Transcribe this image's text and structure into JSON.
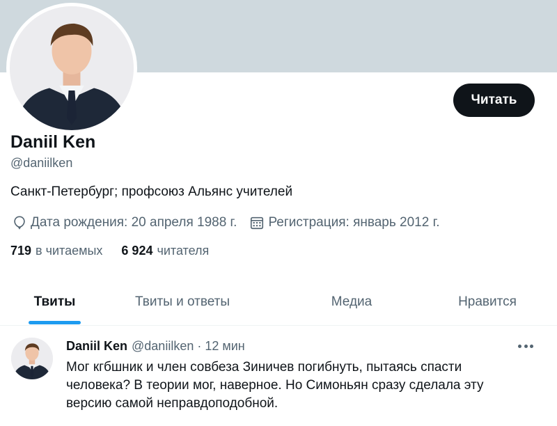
{
  "profile": {
    "name": "Daniil Ken",
    "handle": "@daniilken",
    "bio": "Санкт-Петербург; профсоюз Альянс учителей",
    "birthday": "Дата рождения: 20 апреля 1988 г.",
    "joined": "Регистрация: январь 2012 г.",
    "following_count": "719",
    "following_label": "в читаемых",
    "followers_count": "6 924",
    "followers_label": "читателя",
    "follow_button": "Читать"
  },
  "tabs": [
    {
      "label": "Твиты",
      "active": true
    },
    {
      "label": "Твиты и ответы",
      "active": false
    },
    {
      "label": "Медиа",
      "active": false
    },
    {
      "label": "Нравится",
      "active": false
    }
  ],
  "tweet": {
    "author": "Daniil Ken",
    "handle": "@daniilken",
    "dot": "·",
    "time": "12 мин",
    "lines": [
      "Мог кгбшник и член совбеза Зиничев погибнуть, пытаясь спасти",
      "человека? В теории мог, наверное. Но Симоньян сразу сделала эту",
      "версию самой неправдоподобной."
    ]
  },
  "icons": {
    "birthday": "balloon-icon",
    "joined": "calendar-icon",
    "more": "more-dots-icon"
  },
  "colors": {
    "banner": "#cfd9de",
    "accent": "#1d9bf0",
    "button_bg": "#0f1419",
    "secondary_text": "#536471"
  }
}
